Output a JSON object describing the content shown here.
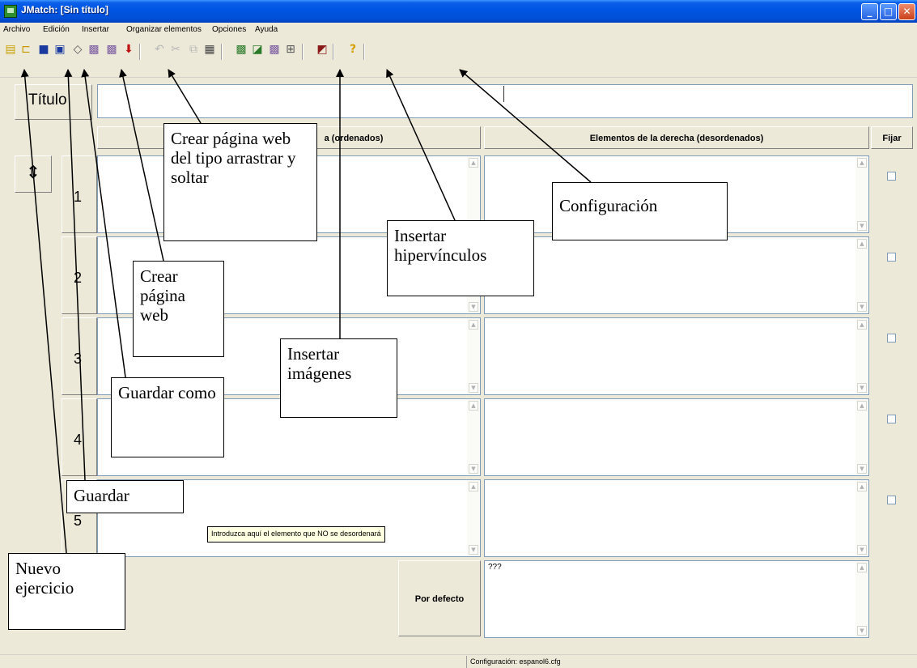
{
  "window": {
    "title": "JMatch: [Sin título]",
    "minimize": "_",
    "maximize": "□",
    "close": "✕"
  },
  "menu": [
    "Archivo",
    "Edición",
    "Insertar",
    "Organizar elementos",
    "Opciones",
    "Ayuda"
  ],
  "toolbar": {
    "icons": [
      "new-icon",
      "open-icon",
      "save-icon",
      "save-as-icon",
      "web-page-icon",
      "drag-drop-page-icon",
      "create-web-icon",
      "export-icon",
      "undo-icon",
      "cut-icon",
      "copy-icon",
      "paste-icon",
      "insert-image-icon",
      "insert-picture-icon",
      "insert-hyperlink-icon",
      "insert-link-icon",
      "configuration-icon",
      "help-icon"
    ],
    "help_glyph": "?"
  },
  "titulo": {
    "label": "Título",
    "value": ""
  },
  "columns": {
    "left_partial": "a (ordenados)",
    "right": "Elementos de la derecha (desordenados)",
    "fijar": "Fijar"
  },
  "rows": [
    {
      "num": "1"
    },
    {
      "num": "2"
    },
    {
      "num": "3"
    },
    {
      "num": "4"
    },
    {
      "num": "5"
    }
  ],
  "default": {
    "button": "Por defecto",
    "value": "???"
  },
  "tooltip": "Introduzca aquí el elemento que NO se desordenará",
  "status": "Configuración: espanol6.cfg",
  "callouts": {
    "drag_drop": "Crear página web del tipo arrastrar y soltar",
    "web": "Crear página web",
    "save_as": "Guardar como",
    "save": "Guardar",
    "new": "Nuevo ejercicio",
    "images": "Insertar imágenes",
    "links": "Insertar hipervínculos",
    "config": "Configuración"
  },
  "colors": {
    "titlebar": "#0054e3",
    "face": "#ece9d8",
    "field_border": "#7f9db9"
  }
}
